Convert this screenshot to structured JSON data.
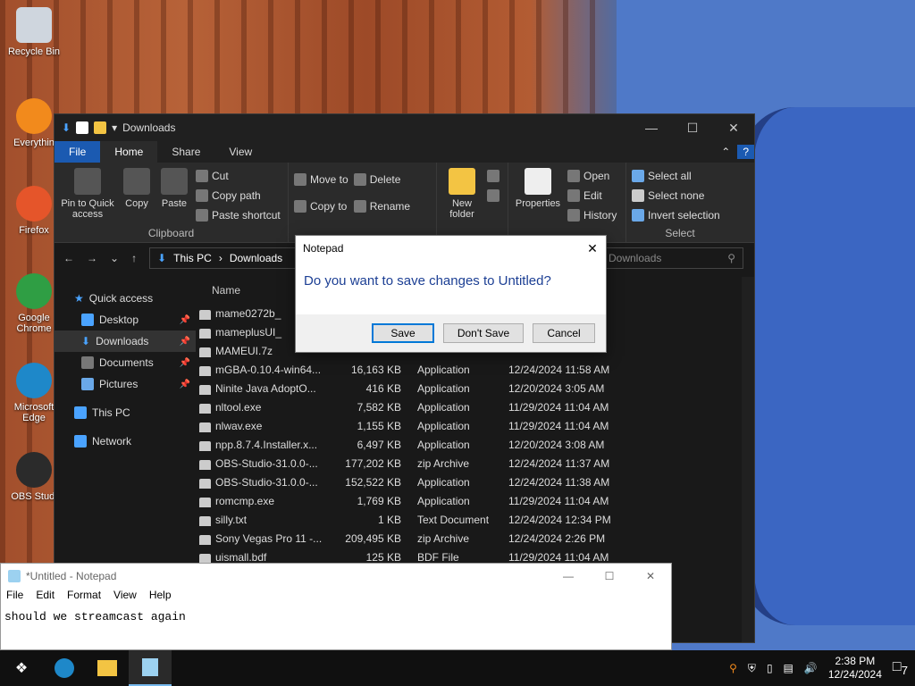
{
  "desktop": {
    "icons": [
      "Recycle Bin",
      "Everythin",
      "Firefox",
      "Google Chrome",
      "Microsoft Edge",
      "OBS Studi"
    ]
  },
  "explorer": {
    "title": "Downloads",
    "tabs": [
      "File",
      "Home",
      "Share",
      "View"
    ],
    "clipboard": {
      "label": "Clipboard",
      "pin": "Pin to Quick access",
      "copy": "Copy",
      "paste": "Paste",
      "cut": "Cut",
      "copy_path": "Copy path",
      "paste_shortcut": "Paste shortcut"
    },
    "organize": {
      "move_to": "Move to",
      "copy_to": "Copy to",
      "delete": "Delete",
      "rename": "Rename"
    },
    "new": {
      "folder": "New folder"
    },
    "open": {
      "properties": "Properties",
      "open": "Open",
      "edit": "Edit",
      "history": "History"
    },
    "select": {
      "label": "Select",
      "all": "Select all",
      "none": "Select none",
      "invert": "Invert selection"
    },
    "address": [
      "This PC",
      "Downloads"
    ],
    "search_placeholder": "Downloads",
    "nav": [
      {
        "label": "Quick access",
        "pin": false
      },
      {
        "label": "Desktop",
        "pin": true
      },
      {
        "label": "Downloads",
        "pin": true
      },
      {
        "label": "Documents",
        "pin": true
      },
      {
        "label": "Pictures",
        "pin": true
      },
      {
        "label": "This PC",
        "pin": false
      },
      {
        "label": "Network",
        "pin": false
      }
    ],
    "header": {
      "name": "Name"
    },
    "files": [
      [
        "mame0272b_",
        "",
        "",
        ""
      ],
      [
        "mameplusUI_",
        "",
        "",
        ""
      ],
      [
        "MAMEUI.7z",
        "",
        "",
        ""
      ],
      [
        "mGBA-0.10.4-win64...",
        "16,163 KB",
        "Application",
        "12/24/2024 11:58 AM"
      ],
      [
        "Ninite Java AdoptO...",
        "416 KB",
        "Application",
        "12/20/2024 3:05 AM"
      ],
      [
        "nltool.exe",
        "7,582 KB",
        "Application",
        "11/29/2024 11:04 AM"
      ],
      [
        "nlwav.exe",
        "1,155 KB",
        "Application",
        "11/29/2024 11:04 AM"
      ],
      [
        "npp.8.7.4.Installer.x...",
        "6,497 KB",
        "Application",
        "12/20/2024 3:08 AM"
      ],
      [
        "OBS-Studio-31.0.0-...",
        "177,202 KB",
        "zip Archive",
        "12/24/2024 11:37 AM"
      ],
      [
        "OBS-Studio-31.0.0-...",
        "152,522 KB",
        "Application",
        "12/24/2024 11:38 AM"
      ],
      [
        "romcmp.exe",
        "1,769 KB",
        "Application",
        "11/29/2024 11:04 AM"
      ],
      [
        "silly.txt",
        "1 KB",
        "Text Document",
        "12/24/2024 12:34 PM"
      ],
      [
        "Sony Vegas Pro 11 -...",
        "209,495 KB",
        "zip Archive",
        "12/24/2024 2:26 PM"
      ],
      [
        "uismall.bdf",
        "125 KB",
        "BDF File",
        "11/29/2024 11:04 AM"
      ]
    ]
  },
  "notepad": {
    "title": "*Untitled - Notepad",
    "menu": [
      "File",
      "Edit",
      "Format",
      "View",
      "Help"
    ],
    "text": "should we streamcast again"
  },
  "dialog": {
    "title": "Notepad",
    "message": "Do you want to save changes to Untitled?",
    "save": "Save",
    "dont_save": "Don't Save",
    "cancel": "Cancel"
  },
  "taskbar": {
    "time": "2:38 PM",
    "date": "12/24/2024",
    "notifications": "7"
  }
}
